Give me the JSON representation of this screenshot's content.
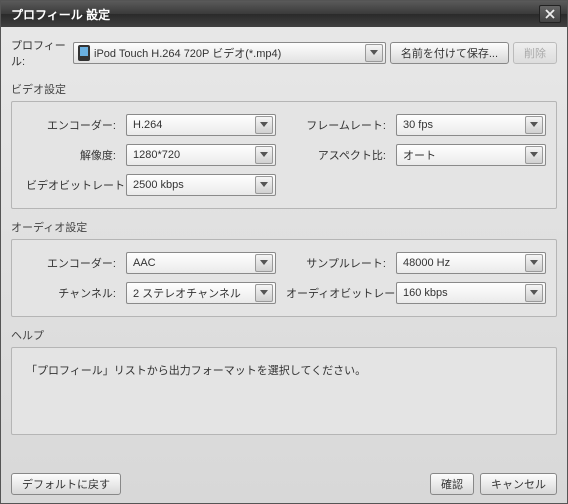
{
  "title": "プロフィール 設定",
  "topRow": {
    "label": "プロフィール:",
    "profile": "iPod Touch H.264 720P ビデオ(*.mp4)",
    "saveAs": "名前を付けて保存...",
    "delete": "削除"
  },
  "video": {
    "title": "ビデオ設定",
    "encoderLabel": "エンコーダー:",
    "encoder": "H.264",
    "resolutionLabel": "解像度:",
    "resolution": "1280*720",
    "bitrateLabel": "ビデオビットレート:",
    "bitrate": "2500 kbps",
    "framerateLabel": "フレームレート:",
    "framerate": "30 fps",
    "aspectLabel": "アスペクト比:",
    "aspect": "オート"
  },
  "audio": {
    "title": "オーディオ設定",
    "encoderLabel": "エンコーダー:",
    "encoder": "AAC",
    "channelLabel": "チャンネル:",
    "channel": "2 ステレオチャンネル",
    "samplerateLabel": "サンプルレート:",
    "samplerate": "48000 Hz",
    "bitrateLabel": "オーディオビットレート:",
    "bitrate": "160 kbps"
  },
  "help": {
    "title": "ヘルプ",
    "text": "「プロフィール」リストから出力フォーマットを選択してください。"
  },
  "footer": {
    "default": "デフォルトに戻す",
    "ok": "確認",
    "cancel": "キャンセル"
  }
}
